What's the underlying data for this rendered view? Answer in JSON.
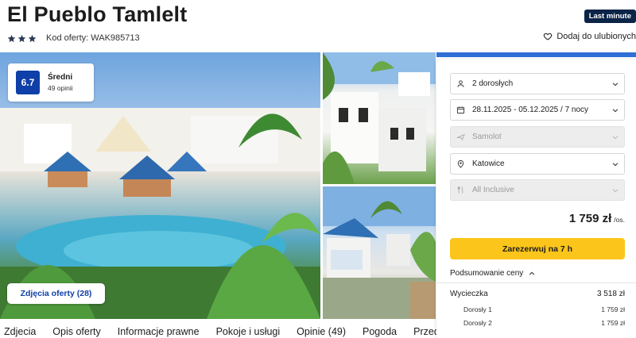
{
  "hotel": {
    "name": "El Pueblo Tamlelt",
    "stars": 3,
    "offer_code": "Kod oferty: WAK985713",
    "badge": "Last minute",
    "favorite_label": "Dodaj do ulubionych"
  },
  "rating": {
    "score": "6.7",
    "label": "Średni",
    "count": "49 opinii"
  },
  "gallery": {
    "photos_button": "Zdjęcia oferty (28)"
  },
  "booking": {
    "travelers": "2 dorosłych",
    "dates": "28.11.2025 - 05.12.2025 / 7 nocy",
    "transport": "Samolot",
    "departure": "Katowice",
    "board": "All Inclusive",
    "price": "1 759 zł",
    "price_unit": "/os.",
    "book_button": "Zarezerwuj na 7 h",
    "summary_label": "Podsumowanie ceny",
    "trip_label": "Wycieczka",
    "trip_total": "3 518 zł",
    "adults": [
      {
        "label": "Dorosły 1",
        "price": "1 759 zł"
      },
      {
        "label": "Dorosły 2",
        "price": "1 759 zł"
      }
    ]
  },
  "tabs": [
    "Zdjecia",
    "Opis oferty",
    "Informacje prawne",
    "Pokoje i usługi",
    "Opinie (49)",
    "Pogoda",
    "Przed"
  ],
  "colors": {
    "brand_blue": "#0f3fa8",
    "badge_navy": "#0b2447",
    "cta_yellow": "#fcc51b"
  }
}
